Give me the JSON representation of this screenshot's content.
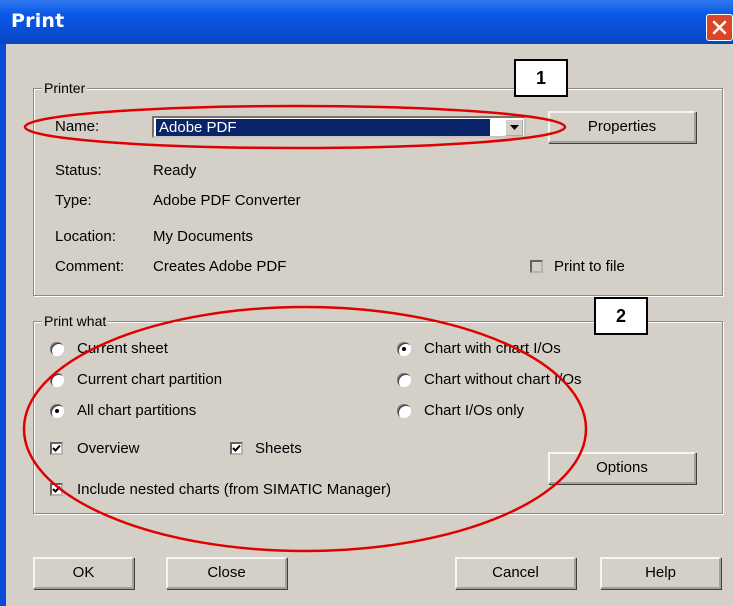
{
  "window": {
    "title": "Print"
  },
  "printer": {
    "legend": "Printer",
    "name_label": "Name:",
    "name_value": "Adobe PDF",
    "properties_label": "Properties",
    "status_label": "Status:",
    "status_value": "Ready",
    "type_label": "Type:",
    "type_value": "Adobe PDF Converter",
    "location_label": "Location:",
    "location_value": "My Documents",
    "comment_label": "Comment:",
    "comment_value": "Creates Adobe PDF",
    "print_to_file_label": "Print to file",
    "print_to_file_checked": false
  },
  "print_what": {
    "legend": "Print what",
    "radio_current_sheet": "Current sheet",
    "radio_current_chart_partition": "Current chart partition",
    "radio_all_chart_partitions": "All chart partitions",
    "radio_chart_with_ios": "Chart with chart I/Os",
    "radio_chart_without_ios": "Chart without chart I/Os",
    "radio_chart_ios_only": "Chart I/Os only",
    "overview_label": "Overview",
    "sheets_label": "Sheets",
    "include_nested_label": "Include nested charts (from SIMATIC Manager)",
    "options_label": "Options"
  },
  "buttons": {
    "ok": "OK",
    "close": "Close",
    "cancel": "Cancel",
    "help": "Help"
  },
  "annotations": {
    "callout_1": "1",
    "callout_2": "2"
  },
  "colors": {
    "titlebar": "#0a4ed6",
    "face": "#d4d0c8",
    "selection": "#0a246a",
    "annotation": "#e00000",
    "close_button": "#d9462b"
  },
  "icons": {
    "close": "close-x-icon",
    "dropdown": "chevron-down-icon",
    "check": "check-icon"
  }
}
